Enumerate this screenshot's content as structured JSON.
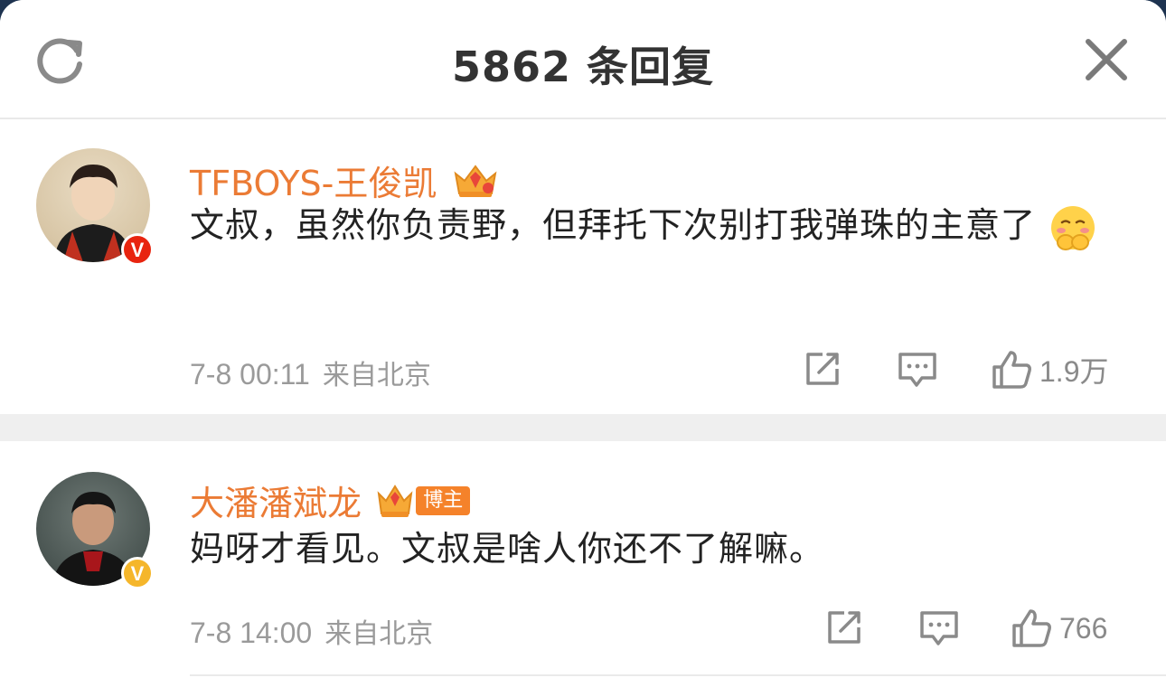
{
  "header": {
    "title": "5862 条回复"
  },
  "colors": {
    "username": "#eb7b35",
    "verified_red": "#e8240f",
    "verified_gold": "#f5b62b",
    "badge_orange": "#f5822a",
    "meta_gray": "#9a9a9a"
  },
  "comments": [
    {
      "username": "TFBOYS-王俊凯",
      "verified": "V",
      "badge_icon": "crown-badge-icon",
      "text": "文叔，虽然你负责野，但拜托下次别打我弹珠的主意了",
      "emoji_icon": "shy-face-emoji-icon",
      "time": "7-8 00:11",
      "location": "来自北京",
      "likes": "1.9万"
    },
    {
      "username": "大潘潘斌龙",
      "verified": "V",
      "badge_icon": "crown-badge-icon",
      "badge_label": "博主",
      "text": "妈呀才看见。文叔是啥人你还不了解嘛。",
      "time": "7-8 14:00",
      "location": "来自北京",
      "likes": "766"
    }
  ]
}
